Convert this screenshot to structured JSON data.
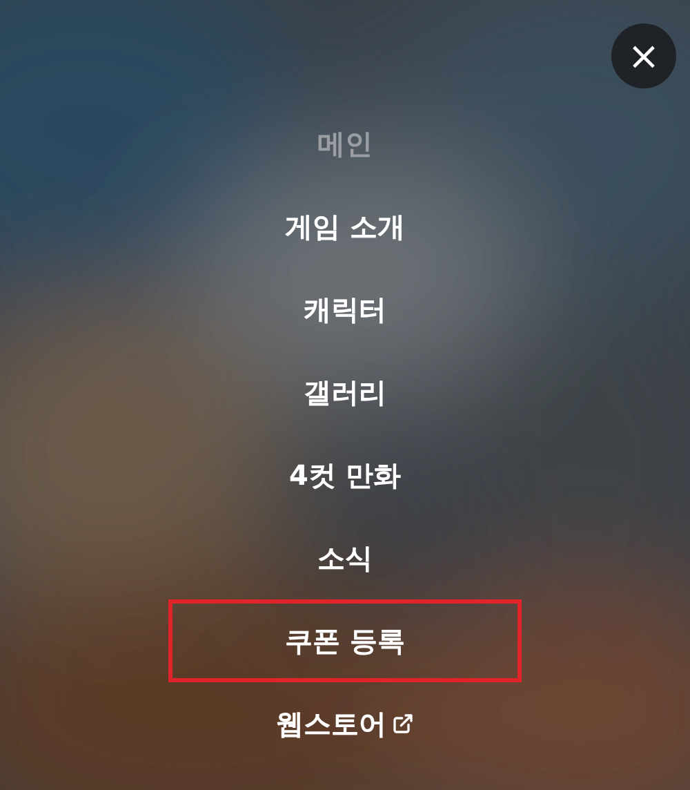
{
  "close_button": {
    "label": "×"
  },
  "menu": [
    {
      "label": "메인",
      "selected": true,
      "highlighted": false,
      "external": false
    },
    {
      "label": "게임 소개",
      "selected": false,
      "highlighted": false,
      "external": false
    },
    {
      "label": "캐릭터",
      "selected": false,
      "highlighted": false,
      "external": false
    },
    {
      "label": "갤러리",
      "selected": false,
      "highlighted": false,
      "external": false
    },
    {
      "label": "4컷 만화",
      "selected": false,
      "highlighted": false,
      "external": false
    },
    {
      "label": "소식",
      "selected": false,
      "highlighted": false,
      "external": false
    },
    {
      "label": "쿠폰 등록",
      "selected": false,
      "highlighted": true,
      "external": false
    },
    {
      "label": "웹스토어",
      "selected": false,
      "highlighted": false,
      "external": true
    }
  ]
}
